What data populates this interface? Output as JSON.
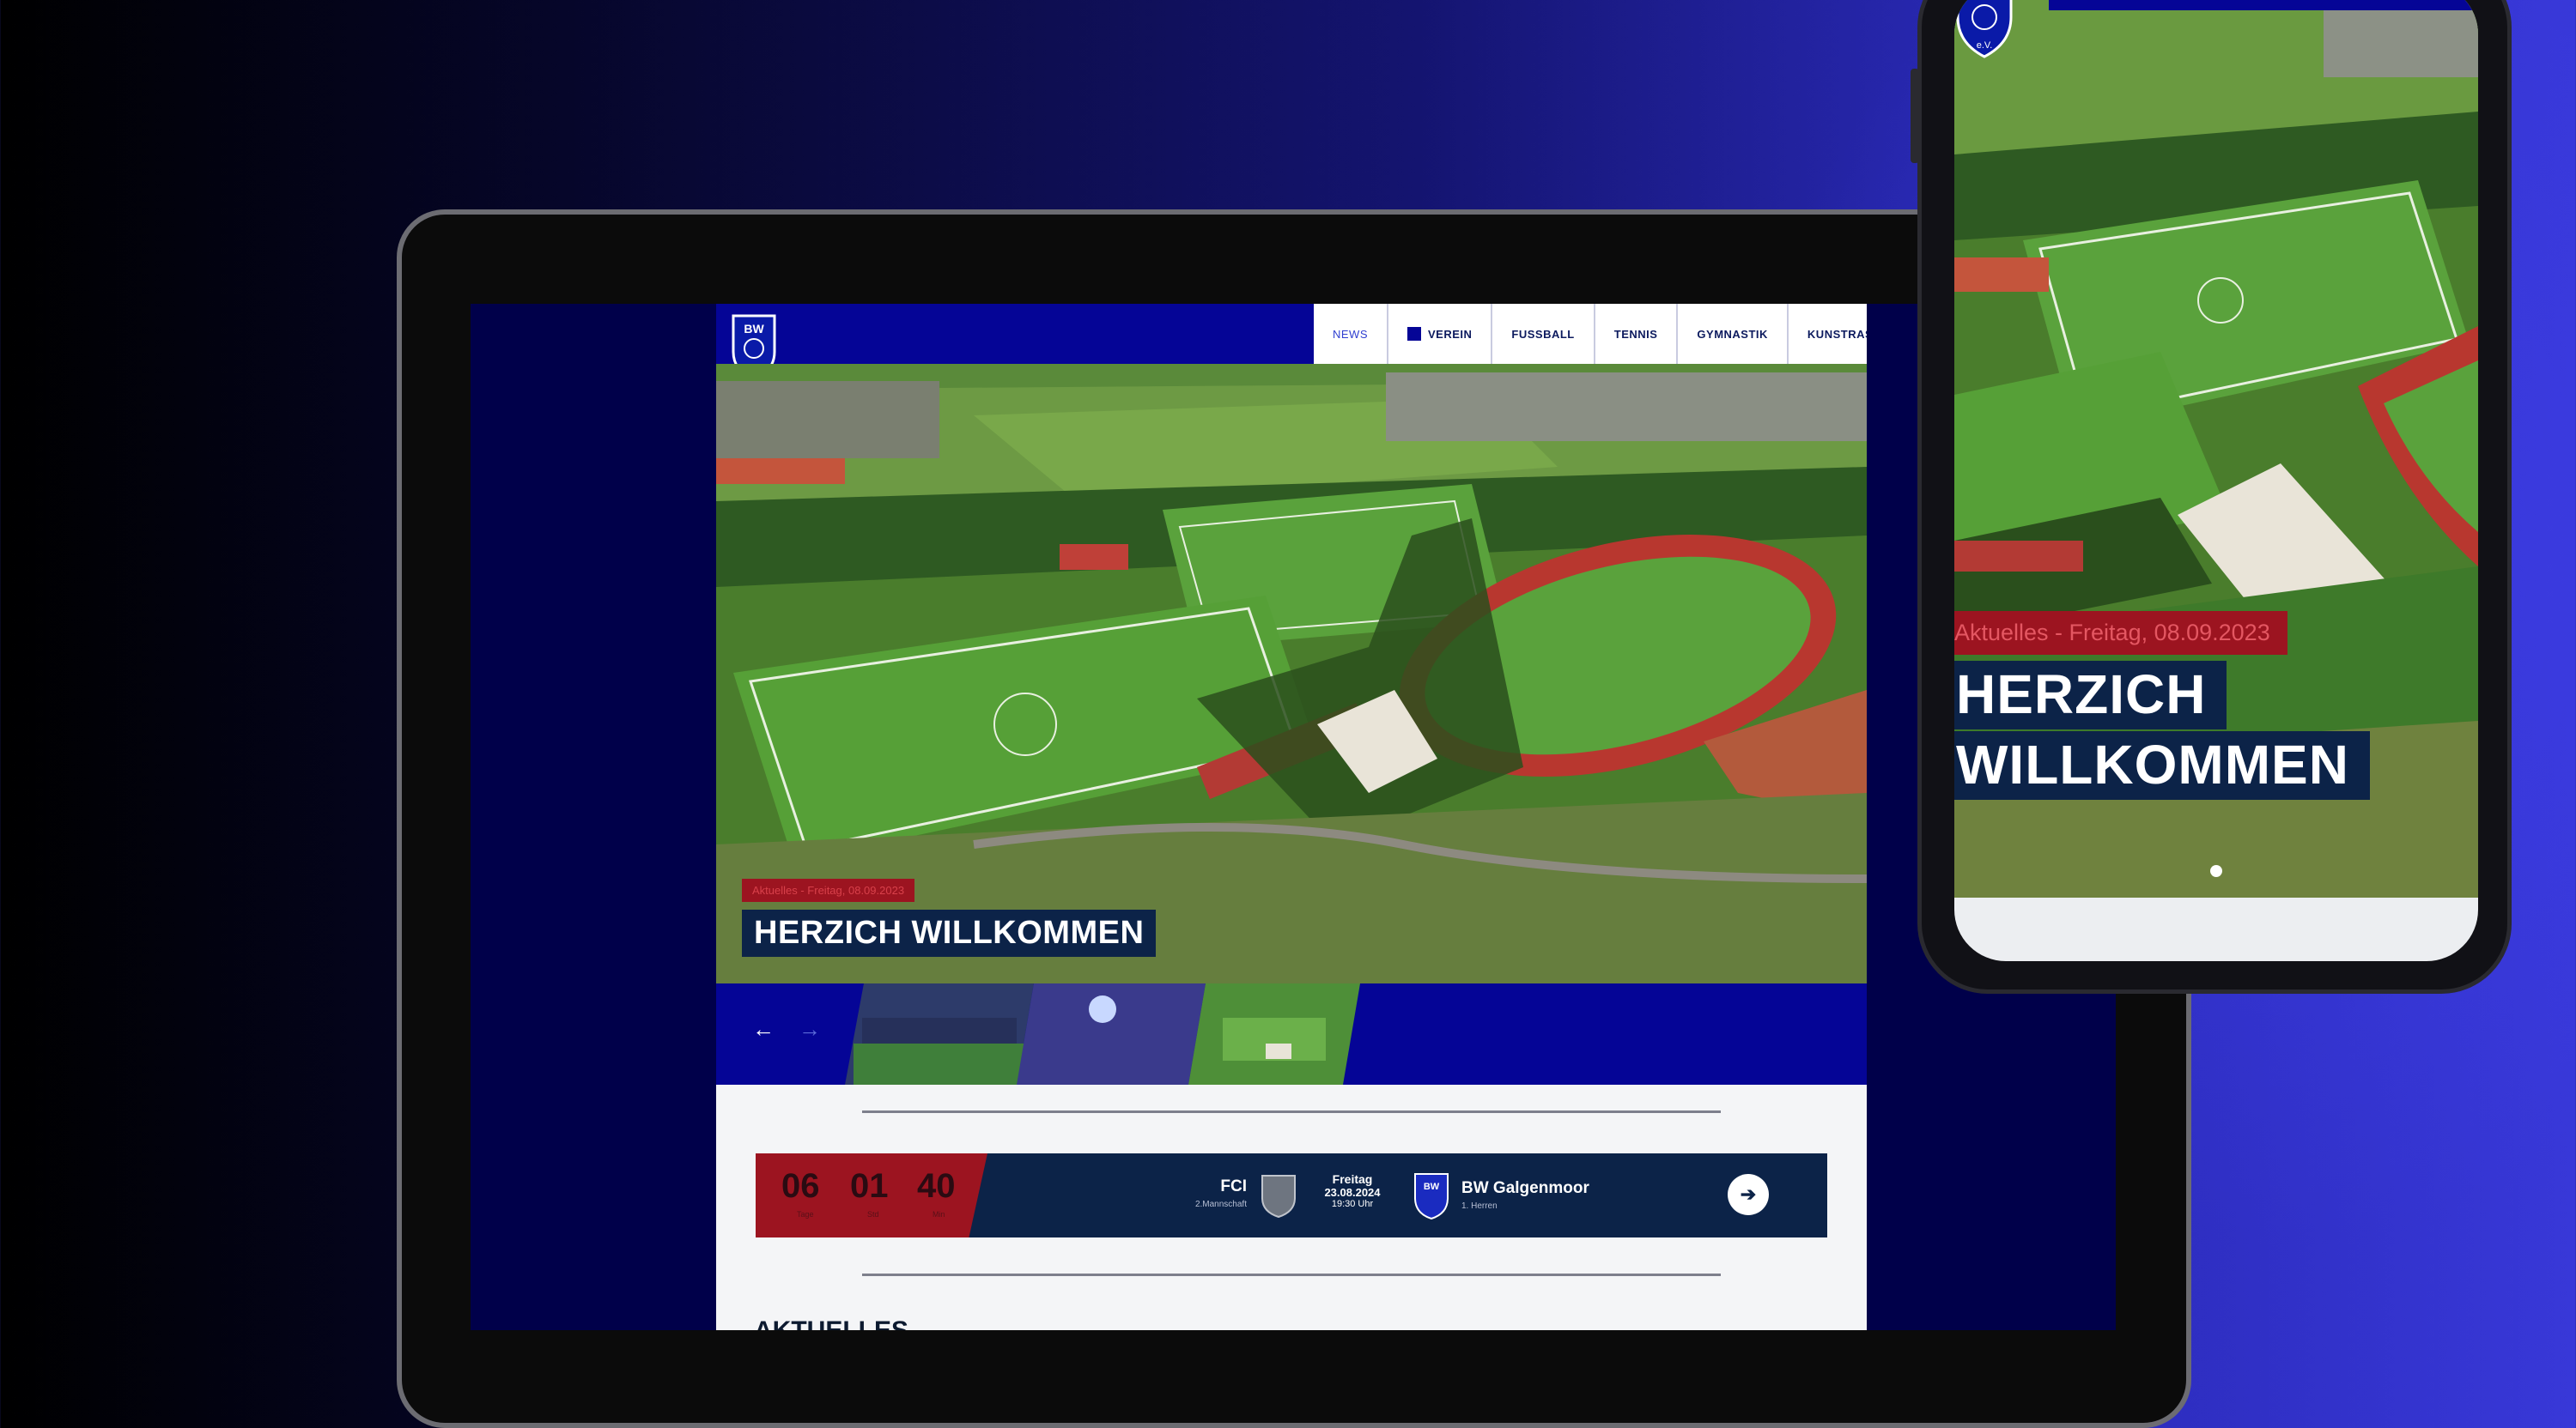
{
  "site": {
    "logo_text": "BW Galgenmoor e.V.",
    "nav": [
      {
        "label": "NEWS",
        "active": true
      },
      {
        "label": "VEREIN",
        "active": false
      },
      {
        "label": "FUSSBALL",
        "active": false
      },
      {
        "label": "TENNIS",
        "active": false
      },
      {
        "label": "GYMNASTIK",
        "active": false
      },
      {
        "label": "KUNSTRASENPLATZ",
        "active": false
      }
    ],
    "hero": {
      "label": "Aktuelles - Freitag, 08.09.2023",
      "title": "HERZICH WILLKOMMEN"
    },
    "slider": {
      "prev_icon": "arrow-left-icon",
      "next_icon": "arrow-right-icon",
      "prev_glyph": "←",
      "next_glyph": "→"
    },
    "countdown": [
      {
        "value": "06",
        "unit": "Tage"
      },
      {
        "value": "01",
        "unit": "Std"
      },
      {
        "value": "40",
        "unit": "Min"
      }
    ],
    "match": {
      "home_team": "FCI",
      "home_sub": "2.Mannschaft",
      "day": "Freitag",
      "date": "23.08.2024",
      "time": "19:30 Uhr",
      "away_team": "BW Galgenmoor",
      "away_sub": "1. Herren",
      "go_glyph": "➔"
    },
    "section_heading": "AKTUELLES"
  },
  "phone": {
    "hero_label": "Aktuelles - Freitag, 08.09.2023",
    "title_line1": "HERZICH",
    "title_line2": "WILLKOMMEN",
    "logo_text": "e.V."
  },
  "colors": {
    "primary_blue": "#050596",
    "navy": "#0c2348",
    "accent_red": "#9c1420",
    "grass": "#4e8b2f",
    "track": "#b8372f"
  }
}
